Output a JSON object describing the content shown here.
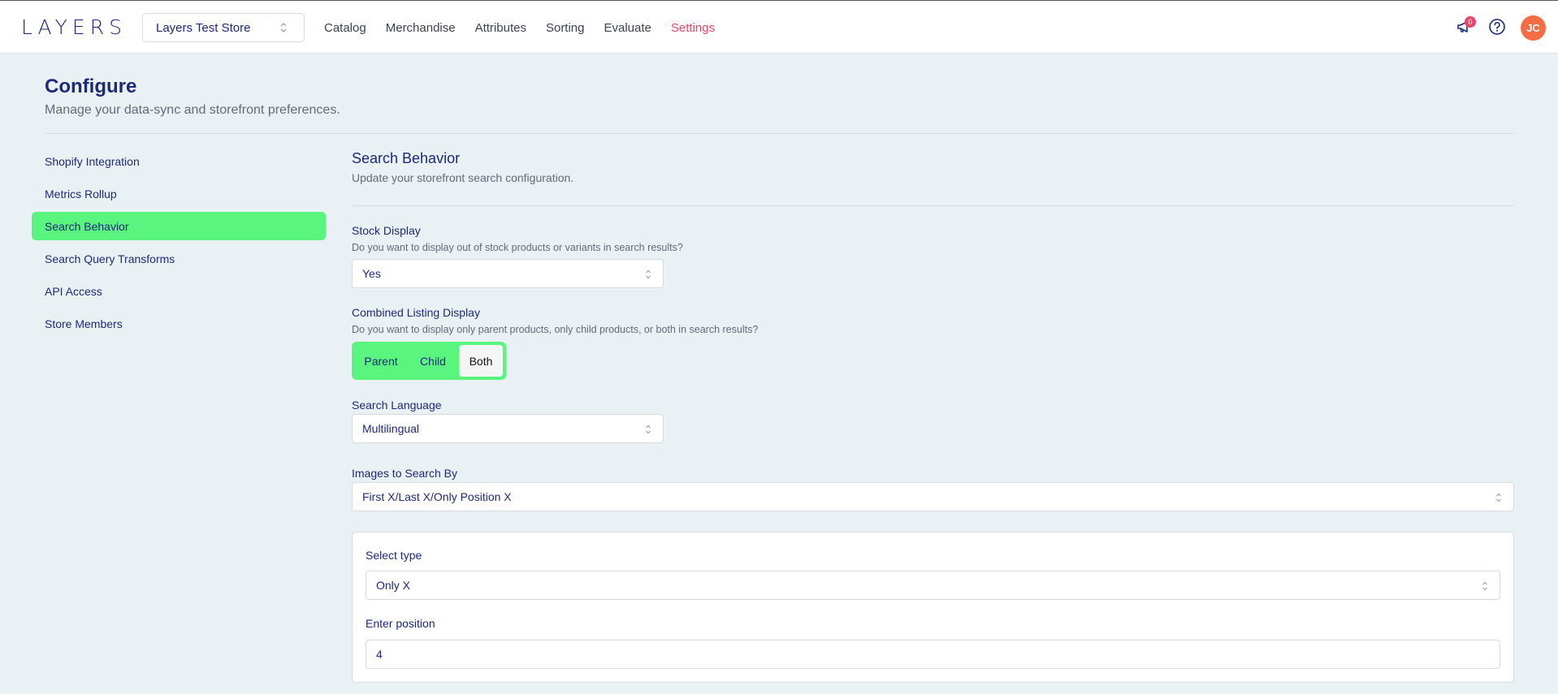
{
  "header": {
    "logo": "LAYERS",
    "store": "Layers Test Store",
    "nav": [
      {
        "label": "Catalog"
      },
      {
        "label": "Merchandise"
      },
      {
        "label": "Attributes"
      },
      {
        "label": "Sorting"
      },
      {
        "label": "Evaluate"
      },
      {
        "label": "Settings"
      }
    ],
    "notification_count": "0",
    "avatar_initials": "JC"
  },
  "page": {
    "title": "Configure",
    "subtitle": "Manage your data-sync and storefront preferences."
  },
  "sidebar": {
    "items": [
      {
        "label": "Shopify Integration"
      },
      {
        "label": "Metrics Rollup"
      },
      {
        "label": "Search Behavior"
      },
      {
        "label": "Search Query Transforms"
      },
      {
        "label": "API Access"
      },
      {
        "label": "Store Members"
      }
    ]
  },
  "section": {
    "title": "Search Behavior",
    "subtitle": "Update your storefront search configuration."
  },
  "stock_display": {
    "label": "Stock Display",
    "hint": "Do you want to display out of stock products or variants in search results?",
    "value": "Yes"
  },
  "combined_listing": {
    "label": "Combined Listing Display",
    "hint": "Do you want to display only parent products, only child products, or both in search results?",
    "options": [
      {
        "label": "Parent"
      },
      {
        "label": "Child"
      },
      {
        "label": "Both"
      }
    ],
    "selected": "Both"
  },
  "search_language": {
    "label": "Search Language",
    "value": "Multilingual"
  },
  "images": {
    "label": "Images to Search By",
    "value": "First X/Last X/Only Position X",
    "select_type_label": "Select type",
    "select_type_value": "Only X",
    "position_label": "Enter position",
    "position_value": "4"
  },
  "colors": {
    "accent_green": "#5af57f",
    "settings_active": "#e24a6b",
    "avatar": "#f46d43",
    "text_primary": "#1e2a78"
  }
}
